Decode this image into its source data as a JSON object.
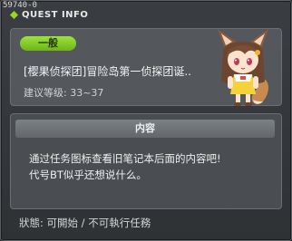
{
  "window": {
    "quest_id": "59740-0",
    "title": "QUEST INFO"
  },
  "header": {
    "category": "一般",
    "quest_name": "[樱果侦探团]冒险岛第一侦探团诞..",
    "level_label": "建议等级:",
    "level_range": "33~37"
  },
  "content": {
    "header": "内容",
    "lines": [
      "通过任务图标查看旧笔记本后面的内容吧!",
      "代号BT似乎还想说什么。"
    ]
  },
  "status": {
    "text": "狀態: 可開始 / 不可執行任務"
  },
  "colors": {
    "badge_green": "#8bd232",
    "panel": "#54585d",
    "window": "#33363a"
  }
}
